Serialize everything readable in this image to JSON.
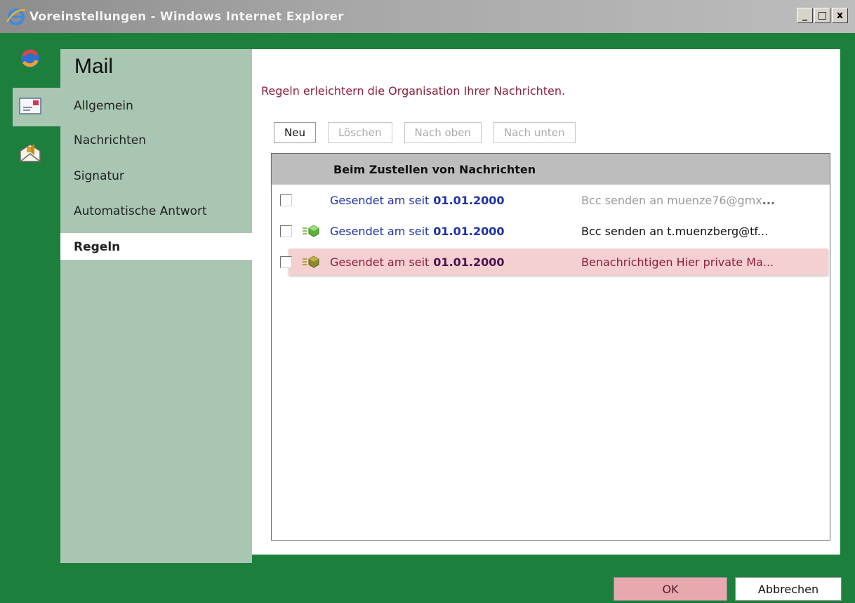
{
  "window": {
    "title": "Voreinstellungen - Windows Internet Explorer",
    "minimize": "_",
    "maximize": "□",
    "close": "x"
  },
  "rail": {
    "icons": [
      "refresh-icon",
      "mail-settings-icon",
      "envelope-speaker-icon"
    ],
    "selected": "mail-settings-icon"
  },
  "nav": {
    "title": "Mail",
    "items": [
      {
        "label": "Allgemein"
      },
      {
        "label": "Nachrichten"
      },
      {
        "label": "Signatur"
      },
      {
        "label": "Automatische Antwort"
      },
      {
        "label": "Regeln",
        "active": true
      }
    ]
  },
  "main": {
    "intro": "Regeln erleichtern die Organisation Ihrer Nachrichten.",
    "toolbar": {
      "new": "Neu",
      "delete": "Löschen",
      "move_up": "Nach oben",
      "move_down": "Nach unten"
    },
    "list": {
      "header": "Beim Zustellen von Nachrichten",
      "rows": [
        {
          "condition": "Gesendet am seit",
          "date": "01.01.2000",
          "action": "Bcc senden an muenze76@gmx",
          "action_tail": "...",
          "active": false,
          "highlighted": false
        },
        {
          "condition": "Gesendet am seit",
          "date": "01.01.2000",
          "action": "Bcc senden an t.muenzberg@tf...",
          "action_tail": "",
          "active": true,
          "highlighted": false
        },
        {
          "condition": "Gesendet am seit",
          "date": "01.01.2000",
          "action": "Benachrichtigen Hier private Ma...",
          "action_tail": "",
          "active": true,
          "highlighted": true
        }
      ]
    }
  },
  "footer": {
    "ok": "OK",
    "cancel": "Abbrechen"
  },
  "colors": {
    "frame_green": "#1d7f3c",
    "panel_green": "#a8c6b1",
    "accent_red": "#8b1d3b",
    "link_blue": "#1d32a5"
  }
}
